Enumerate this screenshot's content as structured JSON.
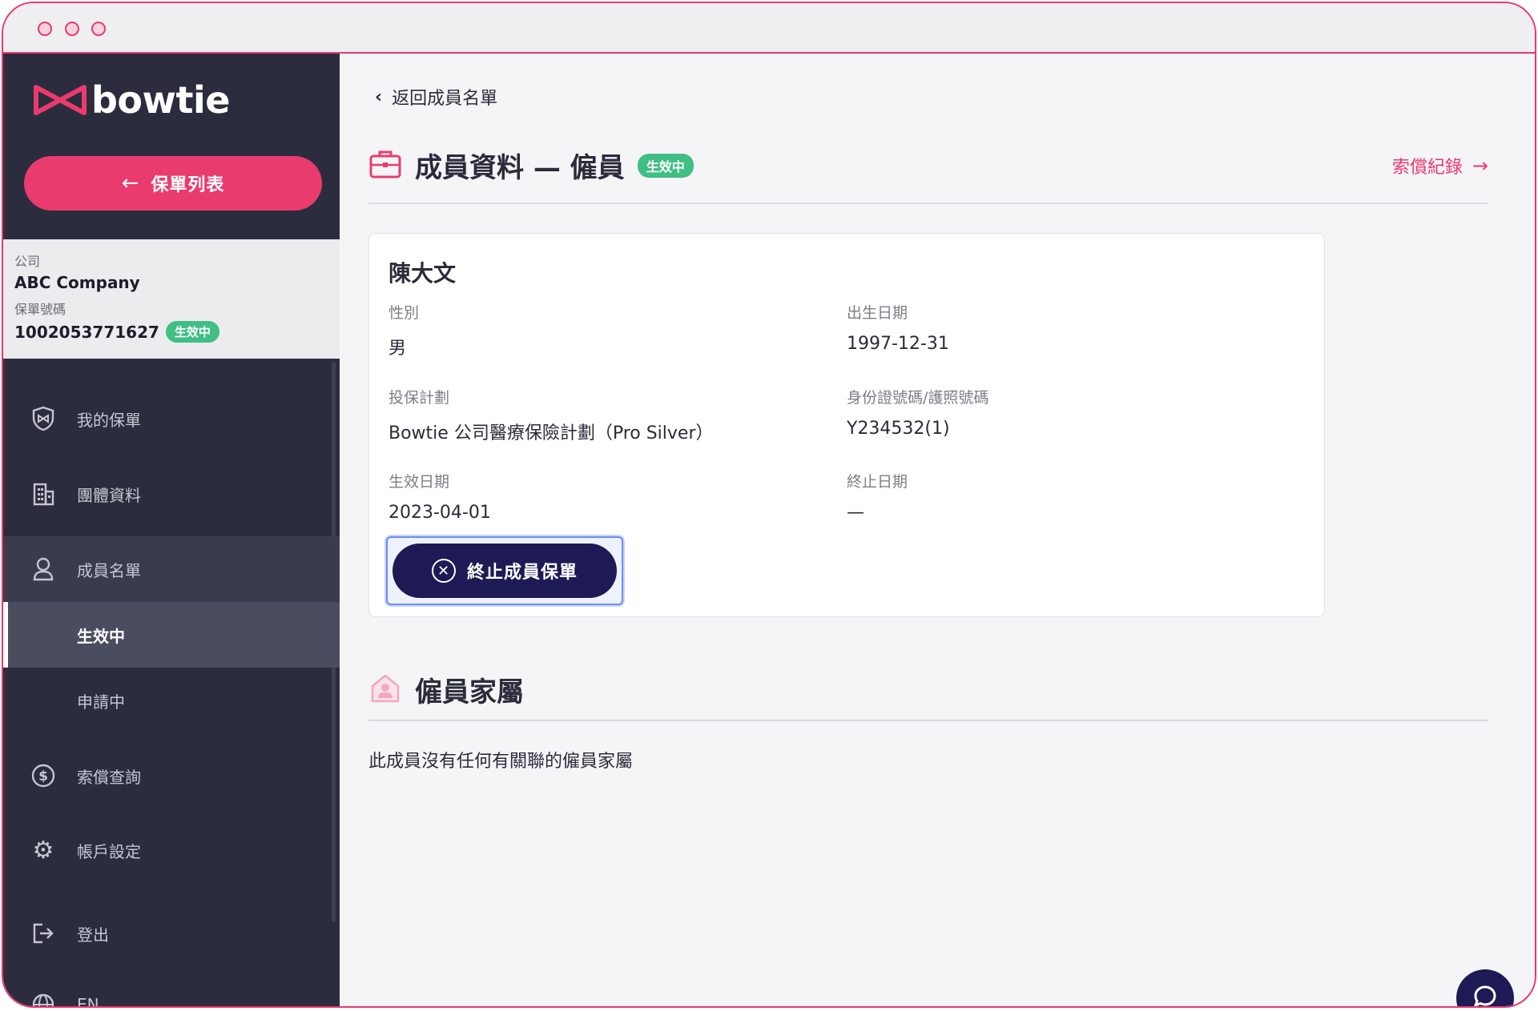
{
  "brand": {
    "logo_text": "bowtie",
    "accent": "#ea3b6e",
    "navy": "#1d1a55",
    "badge_green": "#3fbf83"
  },
  "sidebar": {
    "policy_list_label": "保單列表",
    "company_label": "公司",
    "company_name": "ABC Company",
    "policy_no_label": "保單號碼",
    "policy_no": "1002053771627",
    "policy_status": "生效中",
    "items": [
      {
        "label": "我的保單",
        "icon": "shield-icon"
      },
      {
        "label": "團體資料",
        "icon": "building-icon"
      },
      {
        "label": "成員名單",
        "icon": "user-icon"
      },
      {
        "label": "生效中",
        "sub": true,
        "selected": true
      },
      {
        "label": "申請中",
        "sub": true
      },
      {
        "label": "索償查詢",
        "icon": "dollar-icon"
      },
      {
        "label": "帳戶設定",
        "icon": "gear-icon"
      },
      {
        "label": "登出",
        "icon": "logout-icon"
      },
      {
        "label": "EN",
        "icon": "globe-icon"
      }
    ]
  },
  "main": {
    "back_label": "返回成員名單",
    "title": "成員資料 — 僱員",
    "status_badge": "生效中",
    "claims_link": "索償紀錄",
    "member": {
      "name": "陳大文",
      "gender_label": "性別",
      "gender": "男",
      "dob_label": "出生日期",
      "dob": "1997-12-31",
      "plan_label": "投保計劃",
      "plan": "Bowtie 公司醫療保險計劃（Pro Silver）",
      "id_label": "身份證號碼/護照號碼",
      "id": "Y234532(1)",
      "effective_label": "生效日期",
      "effective": "2023-04-01",
      "end_label": "終止日期",
      "end": "—"
    },
    "terminate_label": "終止成員保單",
    "dependents_title": "僱員家屬",
    "dependents_empty": "此成員沒有任何有關聯的僱員家屬"
  }
}
